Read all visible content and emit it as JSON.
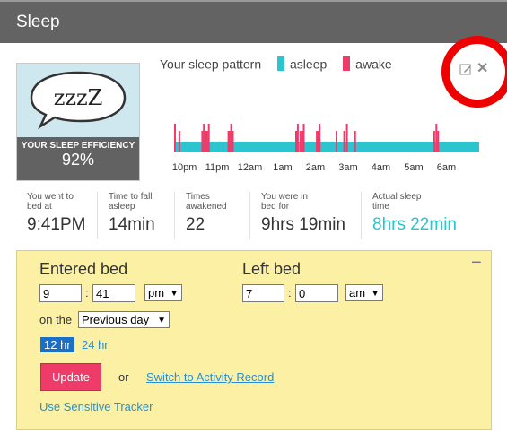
{
  "header": {
    "title": "Sleep"
  },
  "efficiency": {
    "bubble_text": "zzzZ",
    "label": "YOUR SLEEP EFFICIENCY",
    "value": "92%"
  },
  "legend": {
    "title": "Your sleep pattern",
    "asleep": "asleep",
    "awake": "awake"
  },
  "colors": {
    "asleep": "#2cc4cf",
    "awake": "#ee3b6a",
    "header": "#636363",
    "entry_bg": "#fbf0a3",
    "link": "#2a8fd0",
    "highlight": "#ee0000"
  },
  "chart_data": {
    "type": "timeline",
    "x_tick_labels": [
      "10pm",
      "11pm",
      "12am",
      "1am",
      "2am",
      "3am",
      "4am",
      "5am",
      "6am"
    ],
    "start_time": "9:41PM",
    "end_time": "6:00AM",
    "awake_minutes_after_start": [
      0,
      8,
      50,
      53,
      56,
      59,
      62,
      98,
      100,
      103,
      106,
      222,
      225,
      230,
      233,
      236,
      260,
      262,
      265,
      296,
      310,
      315,
      330,
      475,
      479,
      482
    ]
  },
  "stats": [
    {
      "label": "You went to bed at",
      "value": "9:41PM"
    },
    {
      "label": "Time to fall asleep",
      "value": "14min"
    },
    {
      "label": "Times awakened",
      "value": "22"
    },
    {
      "label": "You were in bed for",
      "value": "9hrs 19min"
    },
    {
      "label": "Actual sleep time",
      "value": "8hrs 22min"
    }
  ],
  "entry": {
    "entered_label": "Entered bed",
    "entered_hour": "9",
    "entered_min": "41",
    "entered_ampm": "pm",
    "left_label": "Left bed",
    "left_hour": "7",
    "left_min": "0",
    "left_ampm": "am",
    "on_the": "on the",
    "day": "Previous day",
    "hr12": "12 hr",
    "hr24": "24 hr",
    "update": "Update",
    "or": "or",
    "switch_link": "Switch to Activity Record",
    "sensitive_link": "Use Sensitive Tracker",
    "colon": ":",
    "minus": "−"
  }
}
